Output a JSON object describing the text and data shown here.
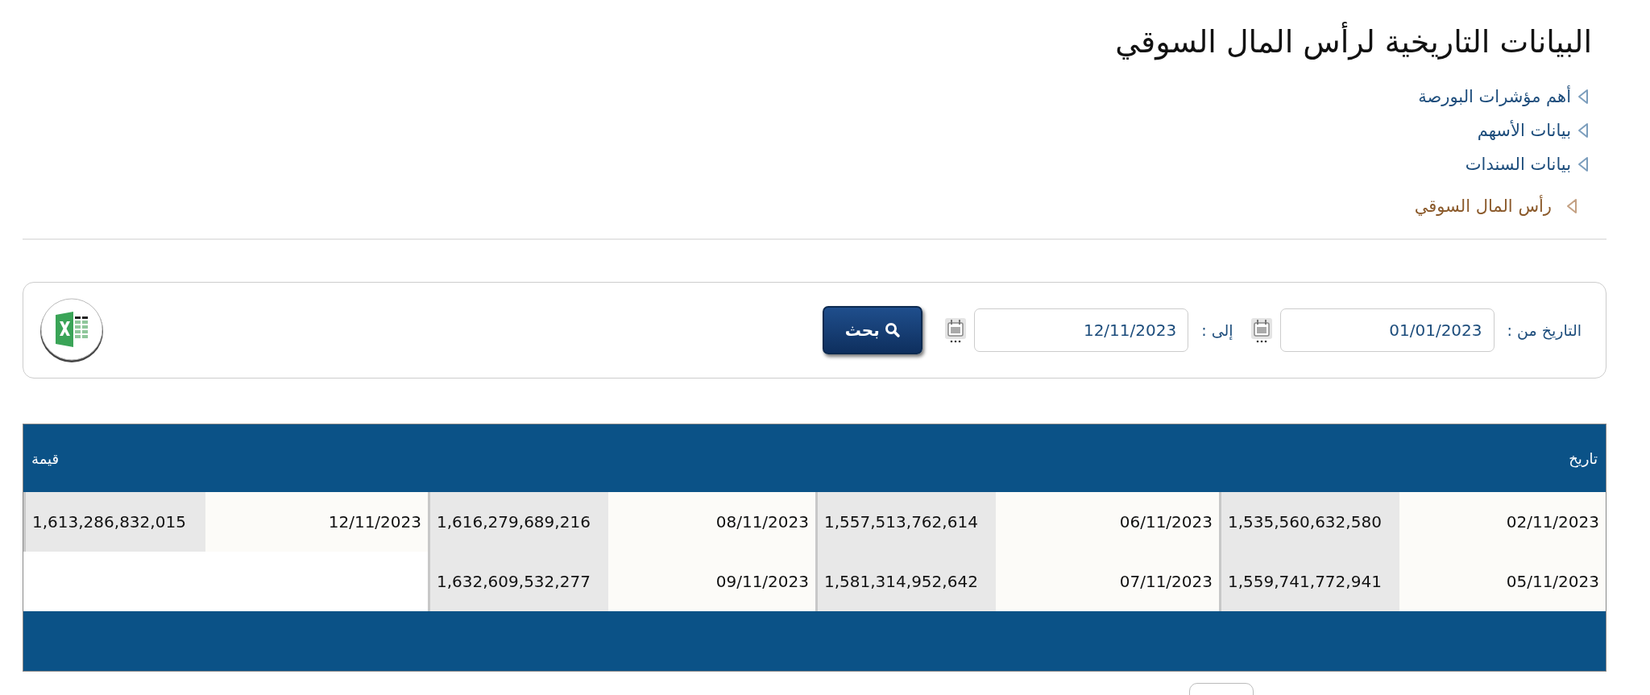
{
  "title": "البيانات التاريخية لرأس المال السوقي",
  "nav": [
    {
      "label": "أهم مؤشرات البورصة",
      "selected": false
    },
    {
      "label": "بيانات الأسهم",
      "selected": false
    },
    {
      "label": "بيانات السندات",
      "selected": false
    },
    {
      "label": "رأس المال السوقي",
      "selected": true
    }
  ],
  "filter": {
    "from_label": "التاريخ من :",
    "from_value": "01/01/2023",
    "to_label": "إلى :",
    "to_value": "12/11/2023",
    "search_button": "بحث"
  },
  "table": {
    "columns": [
      "تاريخ",
      "",
      "",
      "",
      "",
      "",
      "",
      "قيمة"
    ],
    "rows": [
      {
        "cells": [
          "02/11/2023",
          "1,535,560,632,580",
          "06/11/2023",
          "1,557,513,762,614",
          "08/11/2023",
          "1,616,279,689,216",
          "12/11/2023",
          "1,613,286,832,015"
        ]
      },
      {
        "cells": [
          "05/11/2023",
          "1,559,741,772,941",
          "07/11/2023",
          "1,581,314,952,642",
          "09/11/2023",
          "1,632,609,532,277",
          "",
          ""
        ]
      }
    ]
  }
}
